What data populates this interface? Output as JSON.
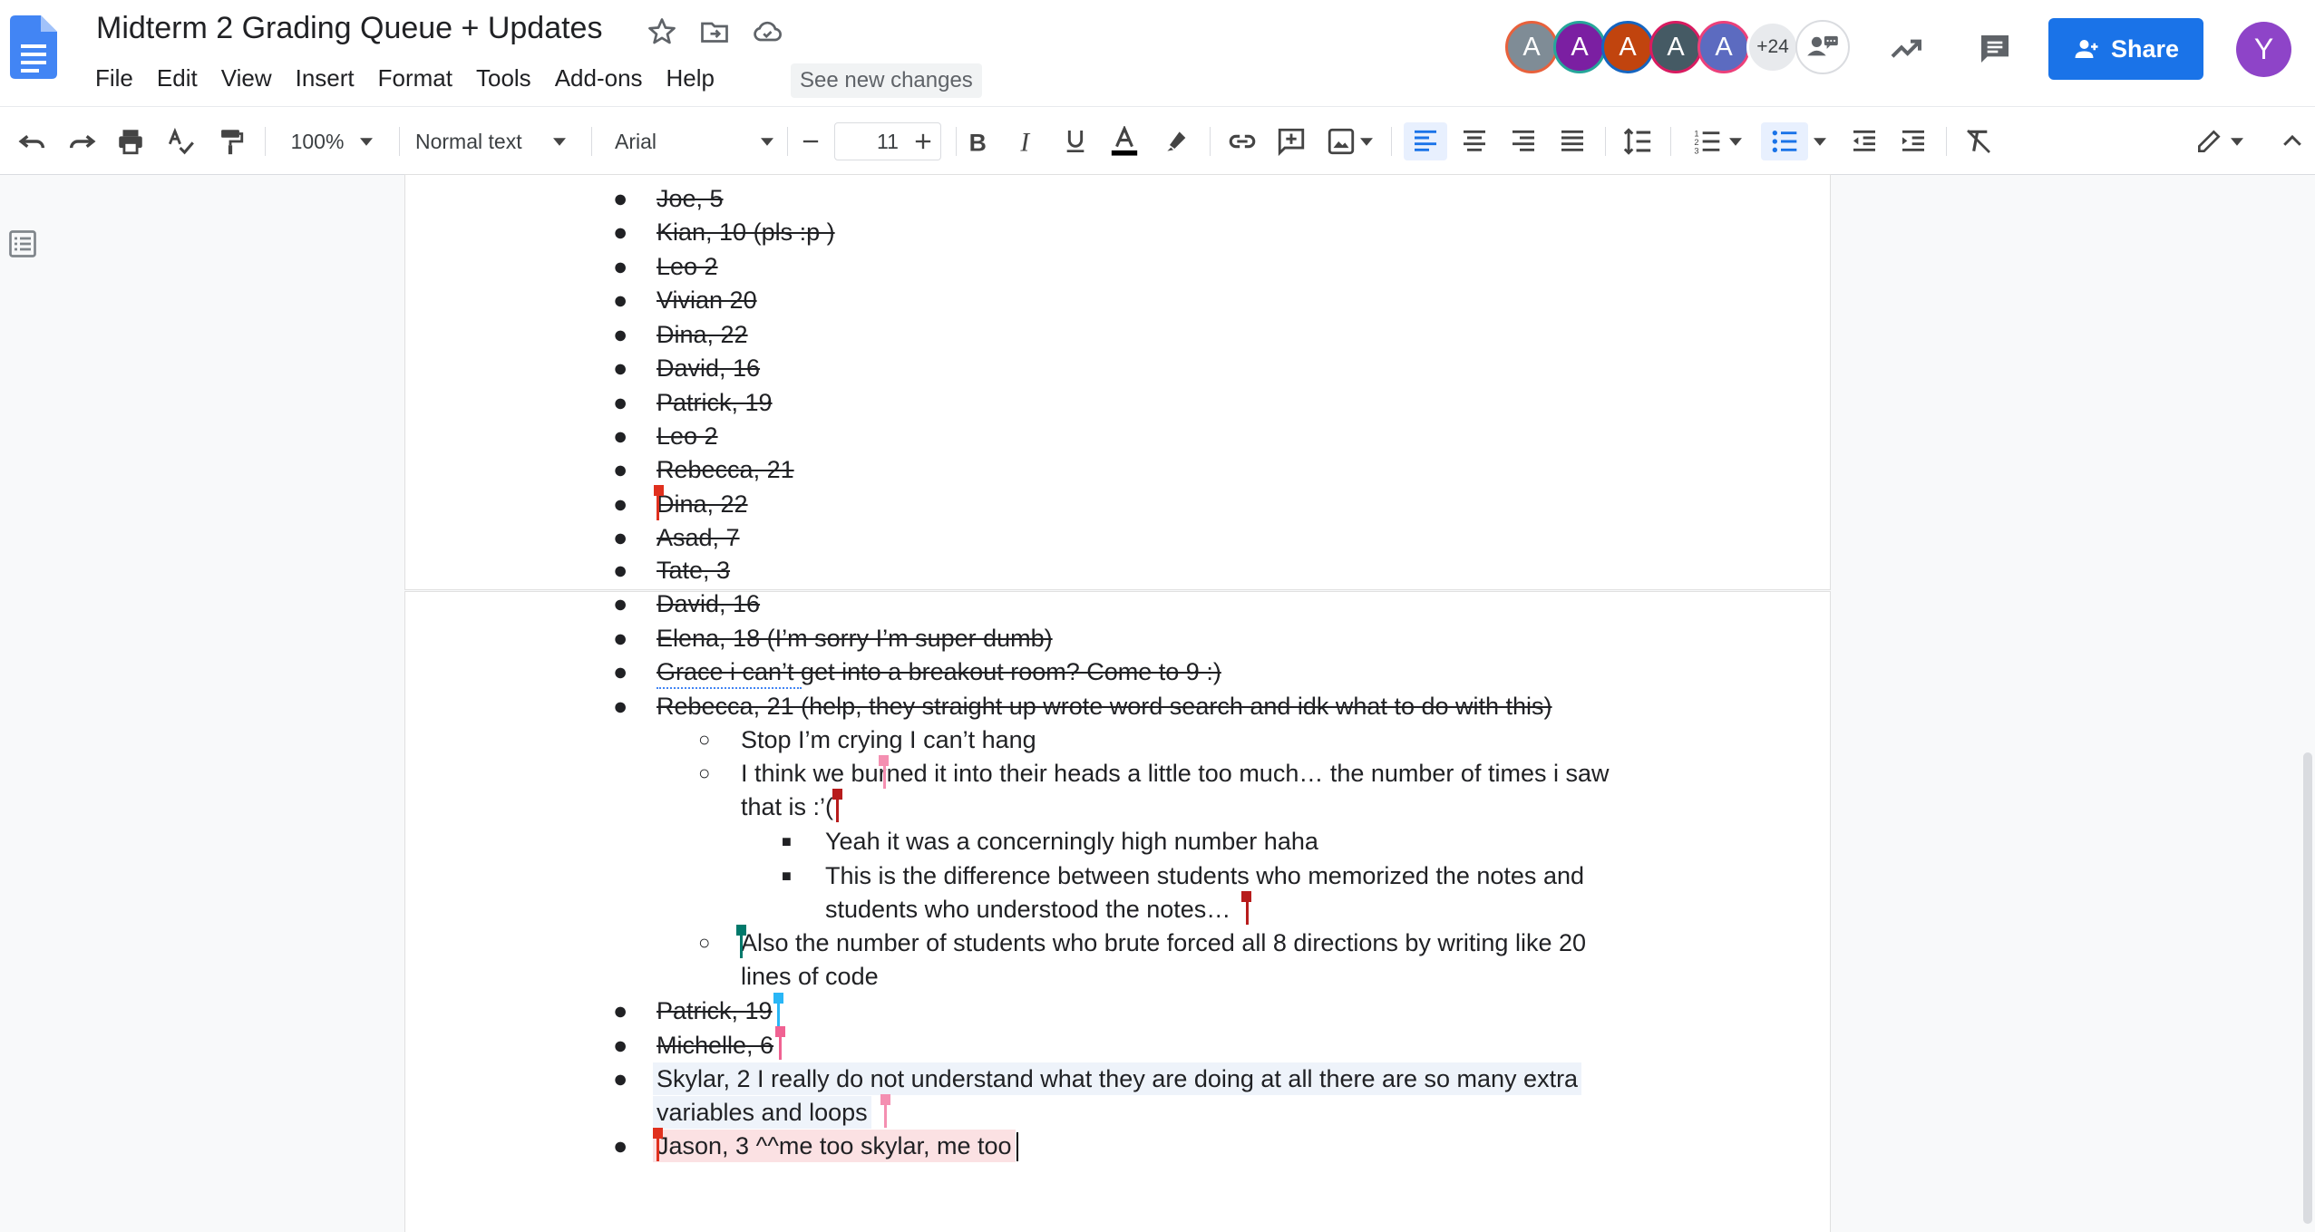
{
  "app": {
    "title": "Midterm 2 Grading Queue + Updates",
    "see_new_changes": "See new changes",
    "menu": [
      "File",
      "Edit",
      "View",
      "Insert",
      "Format",
      "Tools",
      "Add-ons",
      "Help"
    ],
    "share_label": "Share",
    "account_initial": "Y",
    "collaborators": [
      {
        "initial": "A",
        "bg": "#7f8c96",
        "ring": "#e8613c"
      },
      {
        "initial": "A",
        "bg": "#7b1fa2",
        "ring": "#26a69a"
      },
      {
        "initial": "A",
        "bg": "#c1440e",
        "ring": "#1565c0"
      },
      {
        "initial": "A",
        "bg": "#455a64",
        "ring": "#d81b60"
      },
      {
        "initial": "A",
        "bg": "#5c6bc0",
        "ring": "#ec407a"
      }
    ],
    "more_collaborators": "+24"
  },
  "toolbar": {
    "zoom": "100%",
    "style": "Normal text",
    "font": "Arial",
    "font_size": "11",
    "colors": {
      "accent": "#1a73e8",
      "text_color_bar": "#000000"
    }
  },
  "document": {
    "page1_items": [
      "Joe, 5",
      "Kian, 10 (pls :p )",
      "Leo 2",
      "Vivian 20",
      "Dina, 22",
      "David, 16",
      "Patrick, 19",
      "Leo 2",
      "Rebecca, 21",
      "Dina, 22",
      "Asad, 7",
      "Tate, 3"
    ],
    "page2": {
      "struck": [
        "David, 16",
        "Elena, 18 (I’m sorry I’m super dumb)",
        "Grace i can’t get into a breakout room? Come to 9 :)",
        "Rebecca, 21 (help, they straight up wrote word search and idk what to do with this)"
      ],
      "sub1": "Stop I’m crying I can’t hang",
      "sub2_line1": "I think we burned it into their heads a little too much… the number of times i saw",
      "sub2_line2": "that is :’(",
      "subsub1": "Yeah it was a concerningly high number haha",
      "subsub2_line1": "This is the difference between students who memorized the notes and",
      "subsub2_line2": "students who understood the notes…",
      "sub3_line1": "Also the number of students who brute forced all 8 directions by writing like 20",
      "sub3_line2": "lines of code",
      "struck2": [
        "Patrick, 19",
        "Michelle, 6"
      ],
      "skylar_line1": "Skylar, 2 I really do not understand what they are doing at all there are so many extra",
      "skylar_line2": "variables and loops",
      "jason": "Jason, 3 ^^me too skylar, me too"
    }
  }
}
